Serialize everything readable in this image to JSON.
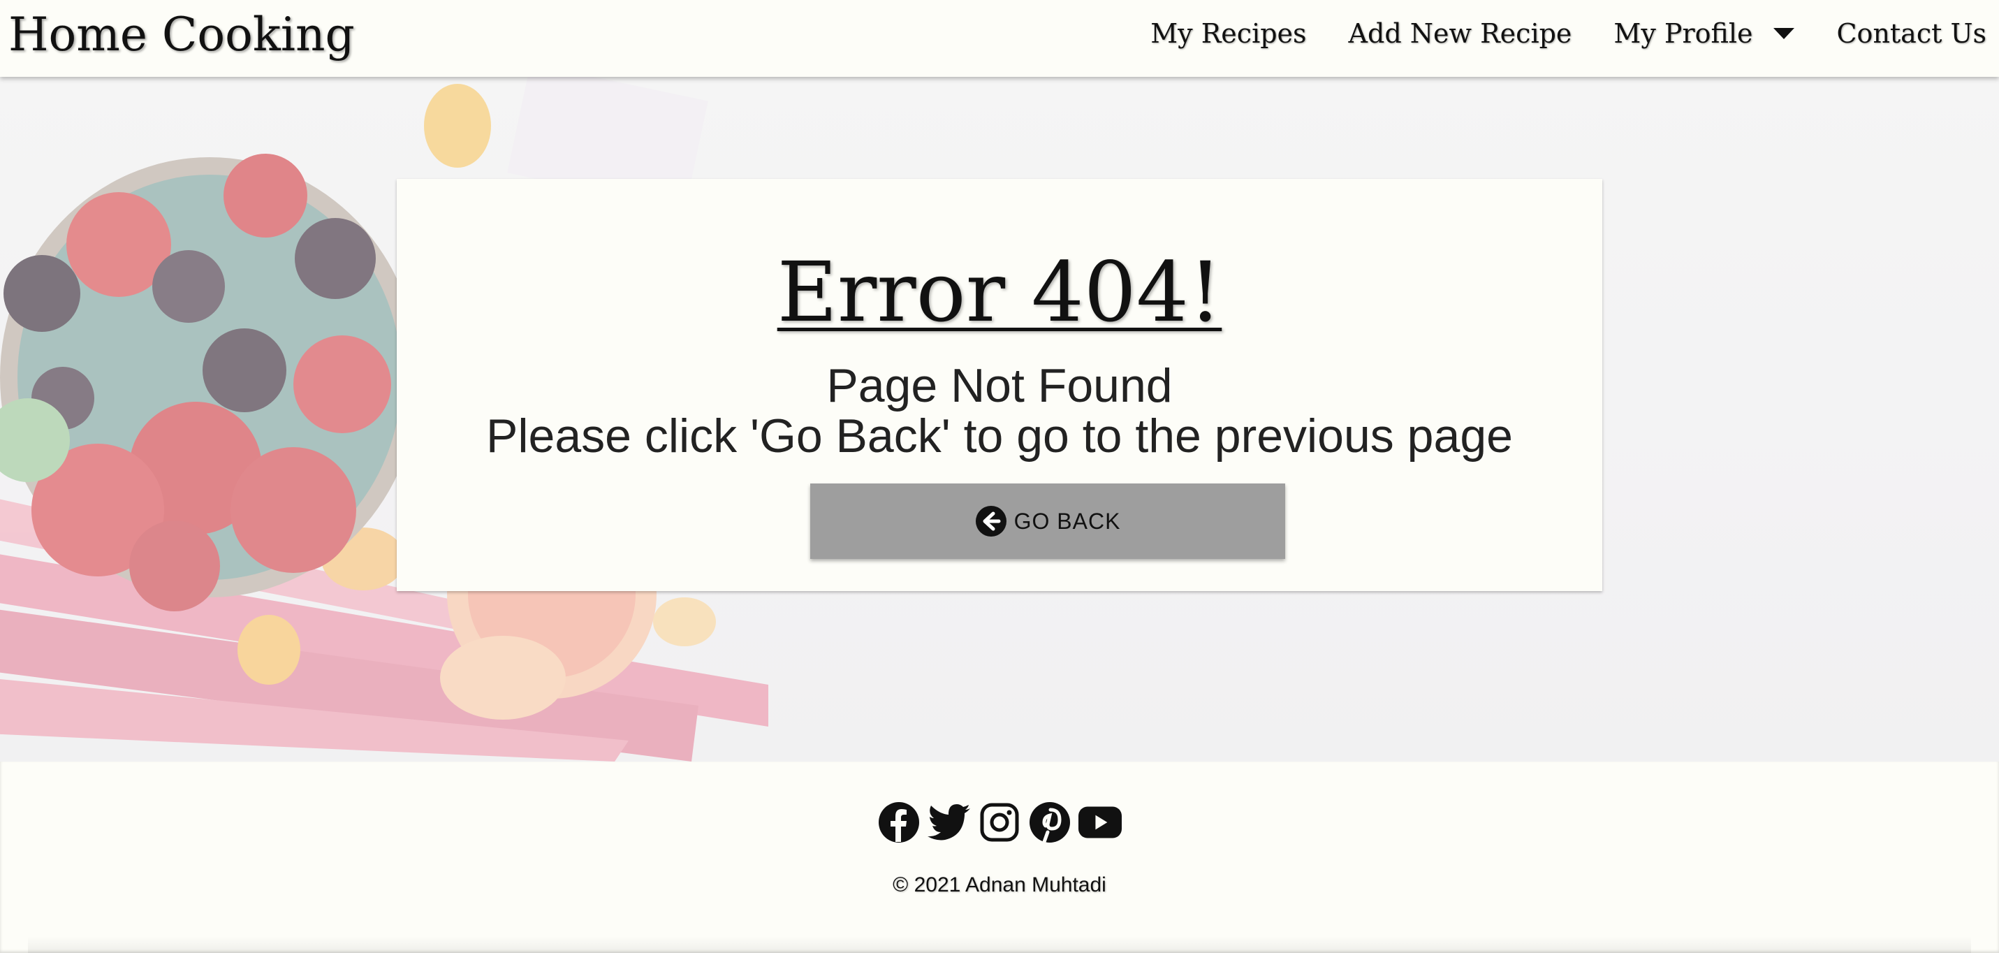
{
  "header": {
    "brand": "Home Cooking",
    "nav": [
      {
        "label": "My Recipes"
      },
      {
        "label": "Add New Recipe"
      },
      {
        "label": "My Profile",
        "icon": "caret-down-icon"
      },
      {
        "label": "Contact Us"
      }
    ]
  },
  "main": {
    "title": "Error 404!",
    "line1": "Page Not Found",
    "line2": "Please click 'Go Back' to go to the previous page",
    "button": {
      "label": "GO BACK",
      "icon": "arrow-left-circle-icon"
    }
  },
  "footer": {
    "socials": [
      "facebook-icon",
      "twitter-icon",
      "instagram-icon",
      "pinterest-icon",
      "youtube-icon"
    ],
    "copyright": "© 2021 Adnan Muhtadi"
  },
  "colors": {
    "background": "#fdfdf8",
    "button": "#9e9e9e",
    "text": "#111111"
  }
}
